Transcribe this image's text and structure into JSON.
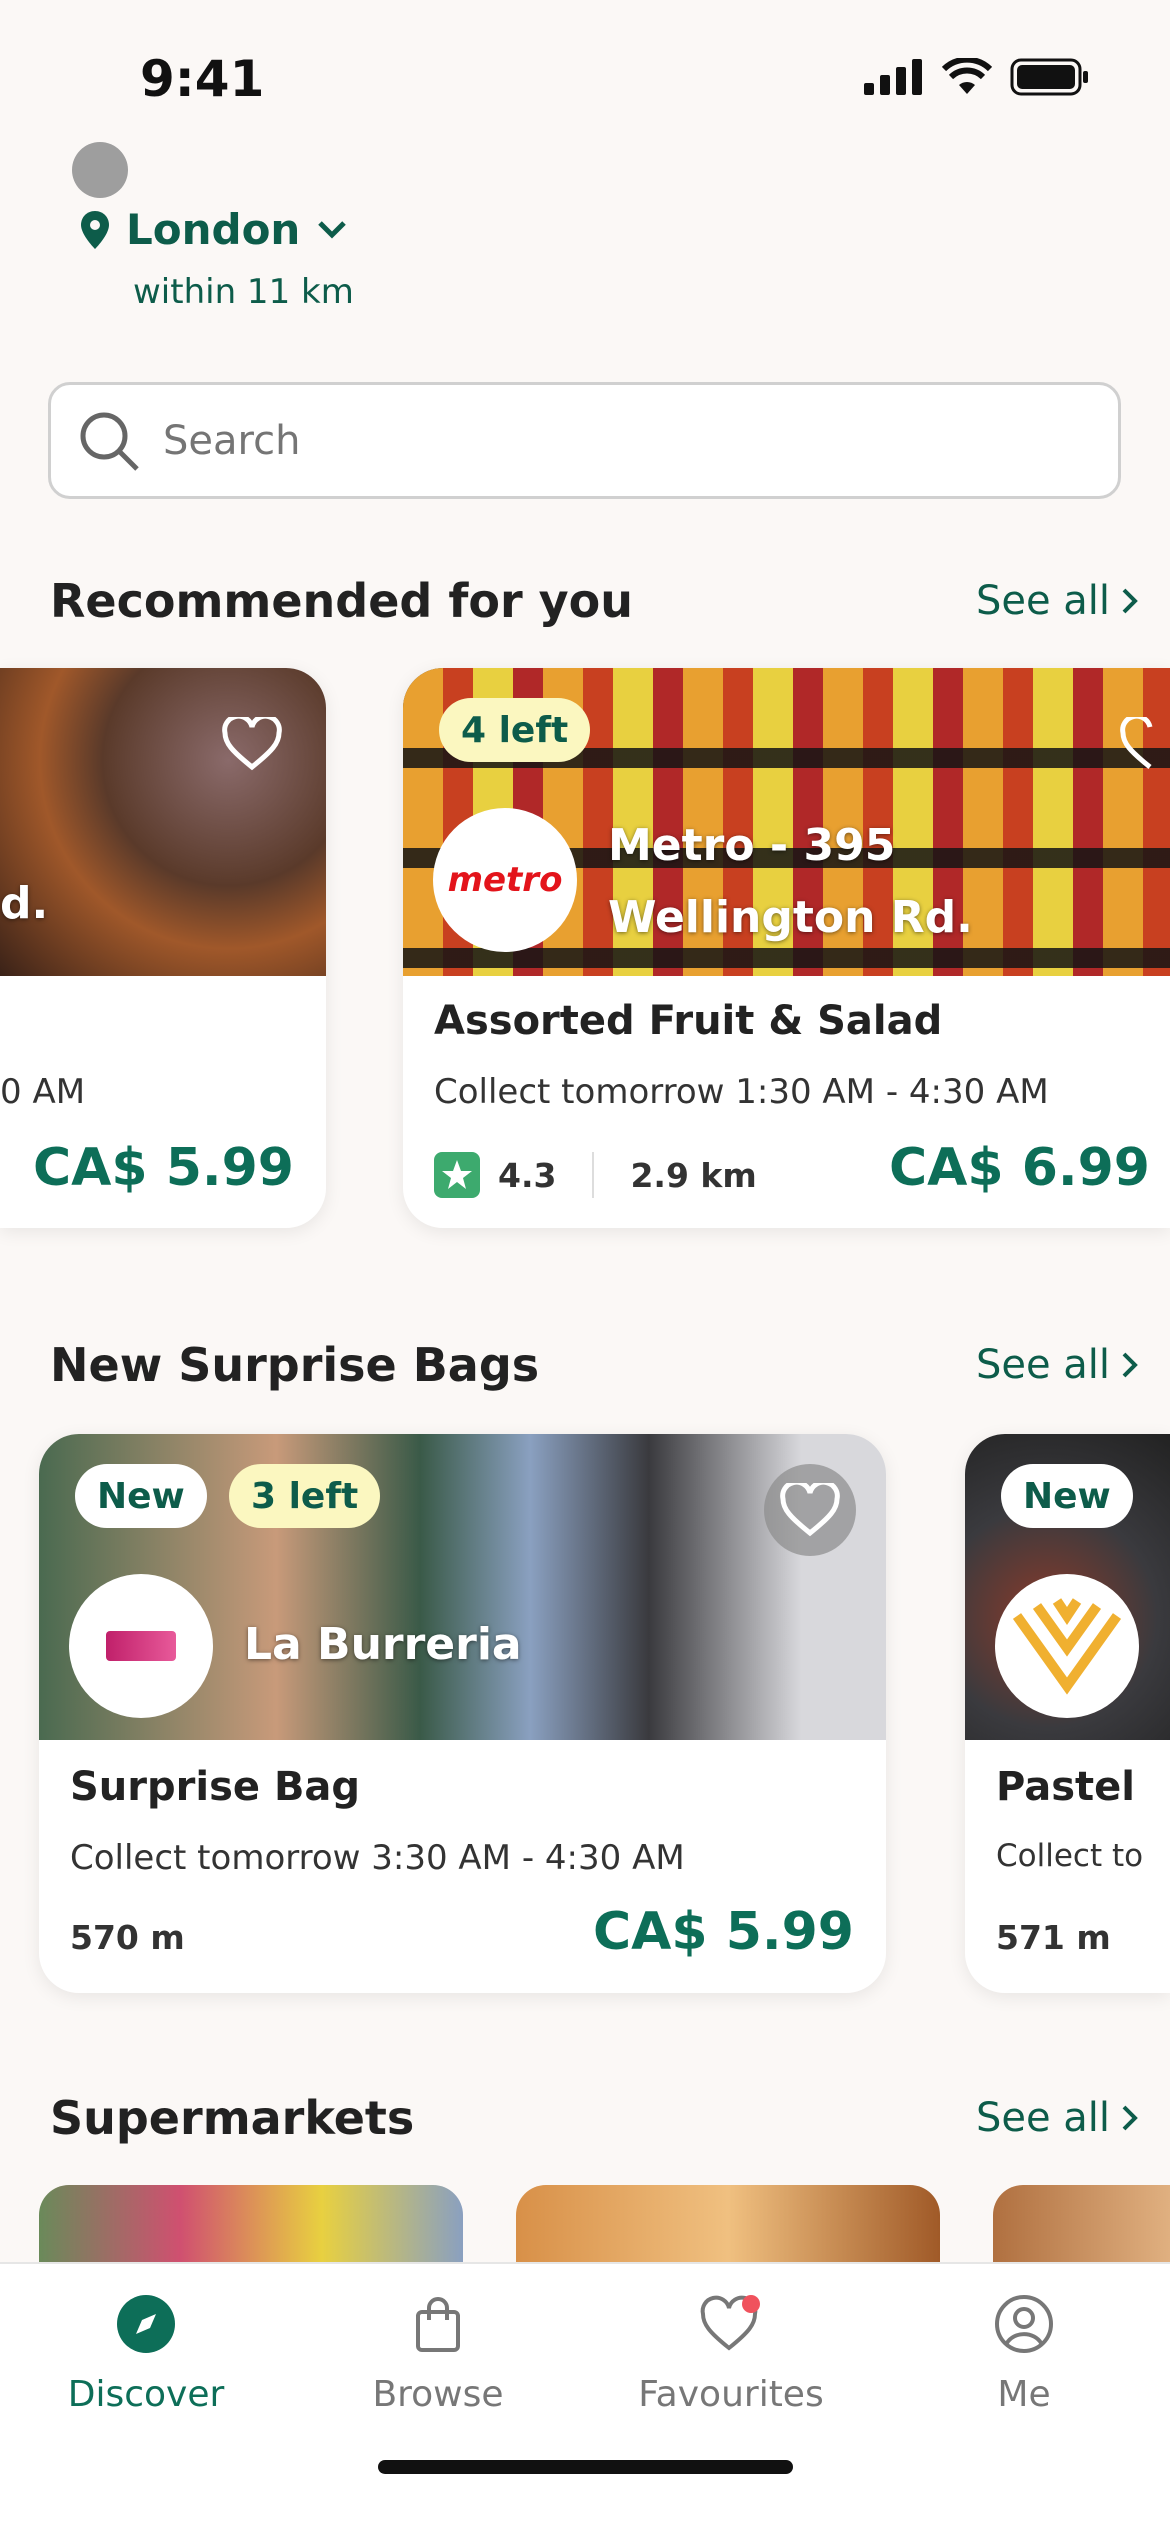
{
  "status_bar": {
    "time": "9:41"
  },
  "location": {
    "city": "London",
    "radius": "within 11 km"
  },
  "search": {
    "placeholder": "Search"
  },
  "recommended": {
    "title": "Recommended for you",
    "see_all": "See all",
    "cards": [
      {
        "store_partial": "d.",
        "collect_partial": "0 AM",
        "price": "CA$ 5.99"
      },
      {
        "badge": "4 left",
        "logo_text": "metro",
        "store": "Metro - 395 Wellington Rd.",
        "store_line1": "Metro - 395",
        "store_line2": "Wellington Rd.",
        "title": "Assorted Fruit & Salad",
        "collect": "Collect tomorrow 1:30 AM - 4:30 AM",
        "rating": "4.3",
        "distance": "2.9 km",
        "price": "CA$ 6.99"
      }
    ]
  },
  "new_bags": {
    "title": "New Surprise Bags",
    "see_all": "See all",
    "cards": [
      {
        "badge_new": "New",
        "badge_left": "3 left",
        "store": "La Burreria",
        "title": "Surprise Bag",
        "collect": "Collect tomorrow 3:30 AM - 4:30 AM",
        "distance": "570 m",
        "price": "CA$ 5.99"
      },
      {
        "badge_new": "New",
        "title": "Pastel",
        "collect": "Collect to",
        "distance": "571 m"
      }
    ]
  },
  "supermarkets": {
    "title": "Supermarkets",
    "see_all": "See all"
  },
  "tabs": [
    {
      "label": "Discover",
      "icon": "compass-icon",
      "active": true
    },
    {
      "label": "Browse",
      "icon": "bag-icon"
    },
    {
      "label": "Favourites",
      "icon": "heart-icon",
      "notification": true
    },
    {
      "label": "Me",
      "icon": "user-icon"
    }
  ],
  "colors": {
    "brand": "#0d6e58",
    "badge_left": "#fbf7c0",
    "notification": "#f0525d"
  }
}
